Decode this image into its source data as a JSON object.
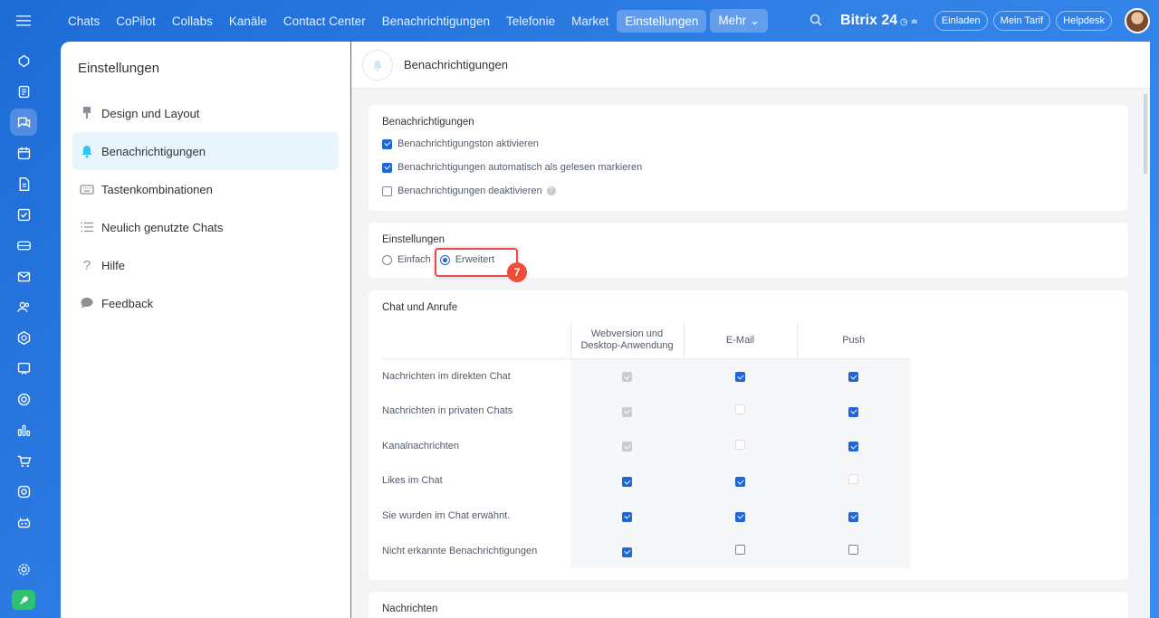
{
  "topnav": {
    "items": [
      {
        "label": "Chats",
        "active": false
      },
      {
        "label": "CoPilot",
        "active": false
      },
      {
        "label": "Collabs",
        "active": false
      },
      {
        "label": "Kanäle",
        "active": false
      },
      {
        "label": "Contact Center",
        "active": false
      },
      {
        "label": "Benachrichtigungen",
        "active": false
      },
      {
        "label": "Telefonie",
        "active": false
      },
      {
        "label": "Market",
        "active": false
      },
      {
        "label": "Einstellungen",
        "active": true
      }
    ],
    "more_label": "Mehr ⌄",
    "brand": "Bitrix 24",
    "invite_label": "Einladen",
    "tariff_label": "Mein Tarif",
    "helpdesk_label": "Helpdesk"
  },
  "sidebar_icons": [
    "menu-icon",
    "copilot-icon",
    "feed-icon",
    "chat-icon",
    "calendar-icon",
    "document-icon",
    "tasks-icon",
    "crm-icon",
    "mail-icon",
    "contacts-icon",
    "sites-icon",
    "training-icon",
    "goals-icon",
    "analytics-icon",
    "shop-icon",
    "automation-icon",
    "bot-icon",
    "settings-icon",
    "rocket-icon"
  ],
  "settings": {
    "title": "Einstellungen",
    "menu": [
      {
        "label": "Design und Layout",
        "icon": "brush-icon",
        "active": false
      },
      {
        "label": "Benachrichtigungen",
        "icon": "bell-icon",
        "active": true
      },
      {
        "label": "Tastenkombinationen",
        "icon": "keyboard-icon",
        "active": false
      },
      {
        "label": "Neulich genutzte Chats",
        "icon": "list-icon",
        "active": false
      },
      {
        "label": "Hilfe",
        "icon": "question-icon",
        "active": false
      },
      {
        "label": "Feedback",
        "icon": "speech-bubble-icon",
        "active": false
      }
    ]
  },
  "main": {
    "header_title": "Benachrichtigungen",
    "notifications_card": {
      "title": "Benachrichtigungen",
      "options": [
        {
          "label": "Benachrichtigungston aktivieren",
          "checked": true
        },
        {
          "label": "Benachrichtigungen automatisch als gelesen markieren",
          "checked": true
        },
        {
          "label": "Benachrichtigungen deaktivieren",
          "checked": false,
          "help": "?"
        }
      ]
    },
    "settings_card": {
      "title": "Einstellungen",
      "radio_simple": "Einfach",
      "radio_advanced": "Erweitert",
      "selected": "Erweitert",
      "step_badge": "7"
    },
    "chat_card": {
      "title": "Chat und Anrufe",
      "columns": [
        "Webversion und Desktop-Anwendung",
        "E-Mail",
        "Push"
      ],
      "rows": [
        {
          "label": "Nachrichten im direkten Chat",
          "values": [
            "disabled-checked",
            "checked",
            "checked"
          ]
        },
        {
          "label": "Nachrichten in privaten Chats",
          "values": [
            "disabled-checked",
            "disabled-unchecked",
            "checked"
          ]
        },
        {
          "label": "Kanalnachrichten",
          "values": [
            "disabled-checked",
            "disabled-unchecked",
            "checked"
          ]
        },
        {
          "label": "Likes im Chat",
          "values": [
            "checked",
            "checked",
            "disabled-unchecked"
          ]
        },
        {
          "label": "Sie wurden im Chat erwähnt.",
          "values": [
            "checked",
            "checked",
            "checked"
          ]
        },
        {
          "label": "Nicht erkannte Benachrichtigungen",
          "values": [
            "checked",
            "unchecked",
            "unchecked"
          ]
        }
      ]
    },
    "messages_card": {
      "title": "Nachrichten"
    }
  }
}
